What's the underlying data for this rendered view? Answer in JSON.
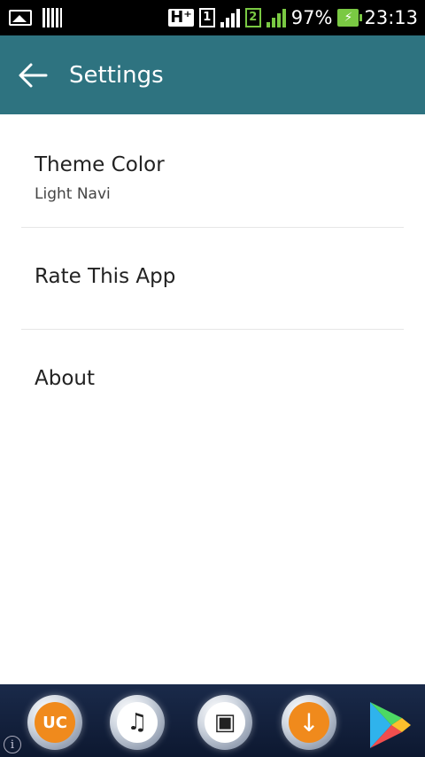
{
  "status_bar": {
    "network": "H⁺",
    "sim1": "1",
    "sim2": "2",
    "battery_percent": "97%",
    "battery_glyph": "⚡",
    "time": "23:13"
  },
  "app_bar": {
    "title": "Settings",
    "back_glyph": "←"
  },
  "settings": {
    "items": [
      {
        "title": "Theme Color",
        "subtitle": "Light Navi"
      },
      {
        "title": "Rate This App"
      },
      {
        "title": "About"
      }
    ]
  },
  "dock": {
    "uc_label": "UC",
    "music_glyph": "♫",
    "video_glyph": "▣",
    "download_glyph": "↓",
    "info_glyph": "i"
  },
  "colors": {
    "app_bar": "#2e7380",
    "status_bar": "#000000",
    "dock": "#1a2a4a",
    "accent_green": "#7ac943",
    "orange": "#f08a1c"
  }
}
